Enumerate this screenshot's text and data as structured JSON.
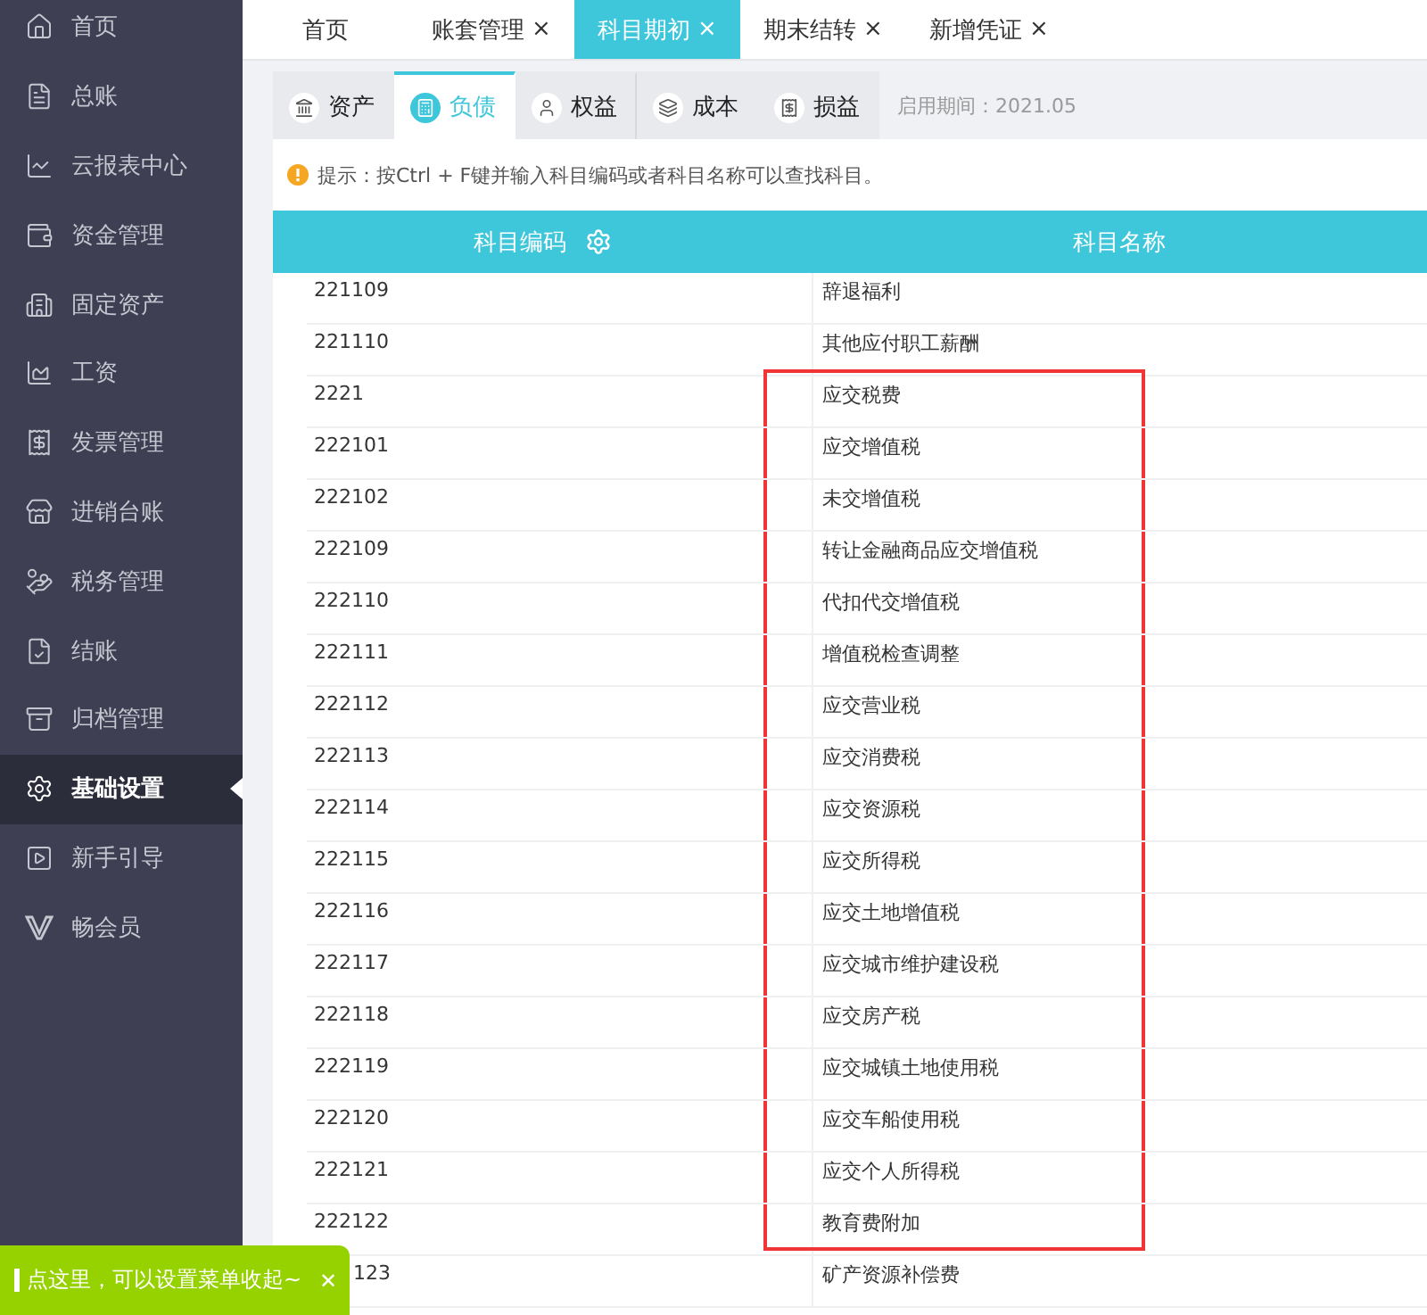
{
  "sidebar": {
    "items": [
      {
        "label": "首页",
        "selected": false
      },
      {
        "label": "总账",
        "selected": false
      },
      {
        "label": "云报表中心",
        "selected": false
      },
      {
        "label": "资金管理",
        "selected": false
      },
      {
        "label": "固定资产",
        "selected": false
      },
      {
        "label": "工资",
        "selected": false
      },
      {
        "label": "发票管理",
        "selected": false
      },
      {
        "label": "进销台账",
        "selected": false
      },
      {
        "label": "税务管理",
        "selected": false
      },
      {
        "label": "结账",
        "selected": false
      },
      {
        "label": "归档管理",
        "selected": false
      },
      {
        "label": "基础设置",
        "selected": true
      },
      {
        "label": "新手引导",
        "selected": false
      },
      {
        "label": "畅会员",
        "selected": false
      }
    ]
  },
  "tabs": [
    {
      "label": "首页",
      "selected": false
    },
    {
      "label": "账套管理",
      "close": "×",
      "selected": false
    },
    {
      "label": "科目期初",
      "close": "×",
      "selected": true
    },
    {
      "label": "期末结转",
      "close": "×",
      "selected": false
    },
    {
      "label": "新增凭证",
      "close": "×",
      "selected": false
    }
  ],
  "subtabs": [
    {
      "label": "资产",
      "selected": false
    },
    {
      "label": "负债",
      "selected": true
    },
    {
      "label": "权益",
      "selected": false
    },
    {
      "label": "成本",
      "selected": false
    },
    {
      "label": "损益",
      "selected": false
    }
  ],
  "start_period": "启用期间：2021.05",
  "hint": "提示：按Ctrl + F键并输入科目编码或者科目名称可以查找科目。",
  "table": {
    "columns": [
      {
        "label": "科目编码"
      },
      {
        "label": "科目名称"
      }
    ],
    "rows": [
      {
        "kind": "row",
        "code": "221109",
        "name": "辞退福利",
        "highlighted": false
      },
      {
        "kind": "row",
        "code": "221110",
        "name": "其他应付职工薪酬",
        "highlighted": false
      },
      {
        "kind": "row",
        "code": "2221",
        "name": "应交税费",
        "highlighted": true
      },
      {
        "kind": "row",
        "code": "222101",
        "name": "应交增值税",
        "highlighted": true
      },
      {
        "kind": "row",
        "code": "222102",
        "name": "未交增值税",
        "highlighted": true
      },
      {
        "kind": "row",
        "code": "222109",
        "name": "转让金融商品应交增值税",
        "highlighted": true
      },
      {
        "kind": "row",
        "code": "222110",
        "name": "代扣代交增值税",
        "highlighted": true
      },
      {
        "kind": "row",
        "code": "222111",
        "name": "增值税检查调整",
        "highlighted": true
      },
      {
        "kind": "row",
        "code": "222112",
        "name": "应交营业税",
        "highlighted": true
      },
      {
        "kind": "row",
        "code": "222113",
        "name": "应交消费税",
        "highlighted": true
      },
      {
        "kind": "row",
        "code": "222114",
        "name": "应交资源税",
        "highlighted": true
      },
      {
        "kind": "row",
        "code": "222115",
        "name": "应交所得税",
        "highlighted": true
      },
      {
        "kind": "row",
        "code": "222116",
        "name": "应交土地增值税",
        "highlighted": true
      },
      {
        "kind": "row",
        "code": "222117",
        "name": "应交城市维护建设税",
        "highlighted": true
      },
      {
        "kind": "row",
        "code": "222118",
        "name": "应交房产税",
        "highlighted": true
      },
      {
        "kind": "row",
        "code": "222119",
        "name": "应交城镇土地使用税",
        "highlighted": true
      },
      {
        "kind": "row",
        "code": "222120",
        "name": "应交车船使用税",
        "highlighted": true
      },
      {
        "kind": "row",
        "code": "222121",
        "name": "应交个人所得税",
        "highlighted": true
      },
      {
        "kind": "row",
        "code": "222122",
        "name": "教育费附加",
        "highlighted": true
      },
      {
        "kind": "covered",
        "code": "123",
        "name": "矿产资源补偿费",
        "highlighted": false
      }
    ]
  },
  "toast": {
    "text": "点这里，可以设置菜单收起~",
    "close": "✕"
  }
}
